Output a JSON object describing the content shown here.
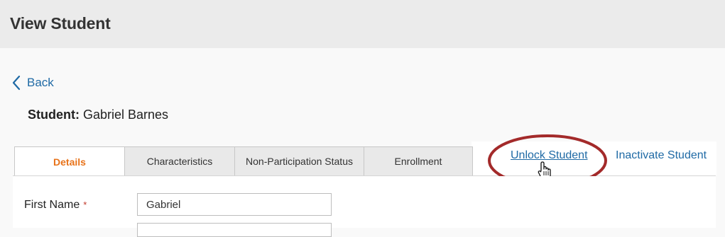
{
  "header": {
    "title": "View Student"
  },
  "nav": {
    "back_label": "Back"
  },
  "student": {
    "label": "Student:",
    "name": "Gabriel Barnes"
  },
  "tabs": [
    {
      "label": "Details",
      "active": true
    },
    {
      "label": "Characteristics",
      "active": false
    },
    {
      "label": "Non-Participation Status",
      "active": false
    },
    {
      "label": "Enrollment",
      "active": false
    }
  ],
  "actions": {
    "unlock_label": "Unlock Student",
    "inactivate_label": "Inactivate Student"
  },
  "form": {
    "first_name": {
      "label": "First Name",
      "required_mark": "*",
      "value": "Gabriel"
    }
  },
  "colors": {
    "accent": "#e8731a",
    "link": "#1f6aa5",
    "highlight": "#a32a2a",
    "required": "#c0392b"
  },
  "icons": [
    "chevron-left-icon",
    "hand-pointer-icon"
  ]
}
